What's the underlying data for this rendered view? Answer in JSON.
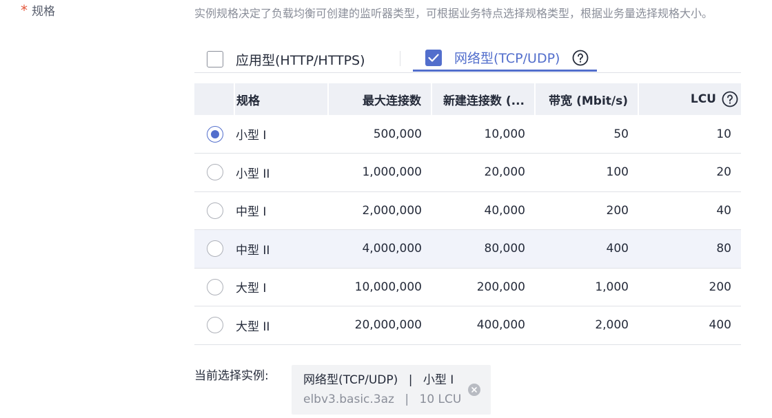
{
  "field": {
    "required_mark": "*",
    "label": "规格"
  },
  "description": "实例规格决定了负载均衡可创建的监听器类型，可根据业务特点选择规格类型，根据业务量选择规格大小。",
  "type_tabs": [
    {
      "label": "应用型(HTTP/HTTPS)",
      "checked": false
    },
    {
      "label": "网络型(TCP/UDP)",
      "checked": true,
      "icon": "help-circle-icon"
    }
  ],
  "table": {
    "headers": {
      "name": "规格",
      "max_conn": "最大连接数",
      "new_conn": "新建连接数 (...",
      "bandwidth": "带宽 (Mbit/s)",
      "lcu": "LCU"
    },
    "rows": [
      {
        "name": "小型 I",
        "max_conn": "500,000",
        "new_conn": "10,000",
        "bandwidth": "50",
        "lcu": "10",
        "selected": true
      },
      {
        "name": "小型 II",
        "max_conn": "1,000,000",
        "new_conn": "20,000",
        "bandwidth": "100",
        "lcu": "20",
        "selected": false
      },
      {
        "name": "中型 I",
        "max_conn": "2,000,000",
        "new_conn": "40,000",
        "bandwidth": "200",
        "lcu": "40",
        "selected": false
      },
      {
        "name": "中型 II",
        "max_conn": "4,000,000",
        "new_conn": "80,000",
        "bandwidth": "400",
        "lcu": "80",
        "selected": false
      },
      {
        "name": "大型 I",
        "max_conn": "10,000,000",
        "new_conn": "200,000",
        "bandwidth": "1,000",
        "lcu": "200",
        "selected": false
      },
      {
        "name": "大型 II",
        "max_conn": "20,000,000",
        "new_conn": "400,000",
        "bandwidth": "2,000",
        "lcu": "400",
        "selected": false
      }
    ]
  },
  "current": {
    "label": "当前选择实例:",
    "type": "网络型(TCP/UDP)",
    "size": "小型 I",
    "flavor": "elbv3.basic.3az",
    "lcu": "10 LCU",
    "separator": "|"
  },
  "colors": {
    "accent": "#526ecc",
    "required": "#e4573c",
    "header_bg": "#eef0f5",
    "hover_row_bg": "#f1f3fa"
  }
}
